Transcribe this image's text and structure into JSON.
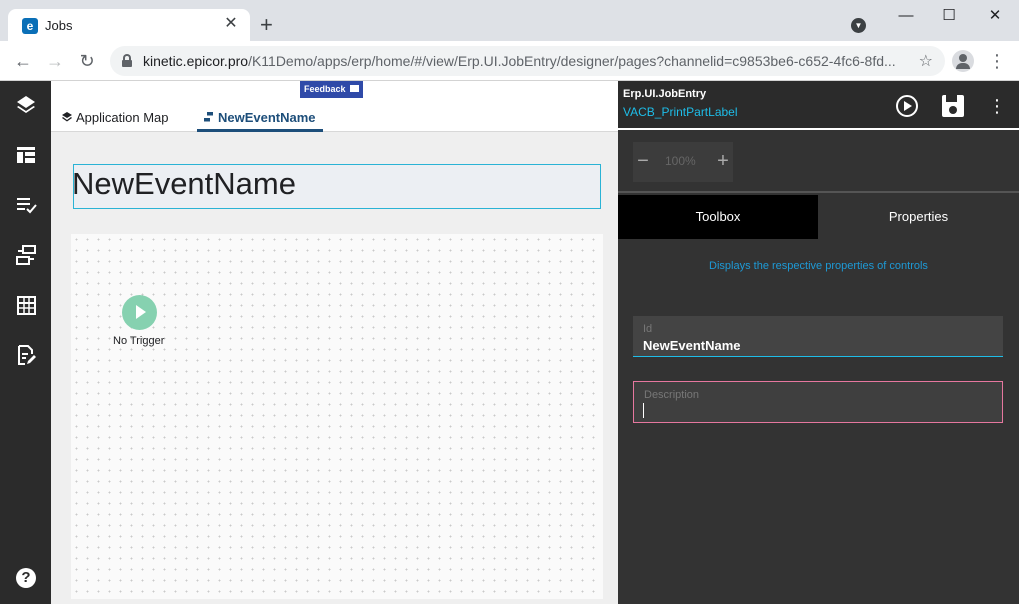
{
  "browser": {
    "tab_title": "Jobs",
    "tab_favicon": "e",
    "url_host": "kinetic.epicor.pro",
    "url_path": "/K11Demo/apps/erp/home/#/view/Erp.UI.JobEntry/designer/pages?channelid=c9853be6-c652-4fc6-8fd...",
    "icons": [
      "back-icon",
      "forward-icon",
      "reload-icon",
      "lock-icon",
      "star-icon",
      "profile-icon",
      "menu-icon"
    ]
  },
  "rail": {
    "icons": [
      "layers-icon",
      "layout-icon",
      "checklist-icon",
      "data-flow-icon",
      "table-icon",
      "edit-document-icon",
      "help-icon"
    ],
    "help_glyph": "?"
  },
  "center": {
    "feedback_label": "Feedback",
    "tabs": [
      {
        "label": "Application Map",
        "active": false
      },
      {
        "label": "NewEventName",
        "active": true
      }
    ],
    "event_name": "NewEventName",
    "trigger_label": "No Trigger"
  },
  "right": {
    "app_name": "Erp.UI.JobEntry",
    "layer_name": "VACB_PrintPartLabel",
    "zoom": {
      "minus": "−",
      "value": "100%",
      "plus": "+"
    },
    "tabs": {
      "toolbox": "Toolbox",
      "properties": "Properties"
    },
    "hint": "Displays the respective properties of controls",
    "id_field": {
      "label": "Id",
      "value": "NewEventName"
    },
    "description_field": {
      "label": "Description",
      "value": ""
    },
    "more_glyph": "⋮"
  },
  "colors": {
    "accent": "#1ebde8",
    "active_tab": "#1d4e7a",
    "feedback": "#2f4aa8",
    "trigger": "#86d1b0",
    "desc_border": "#e6779f"
  }
}
